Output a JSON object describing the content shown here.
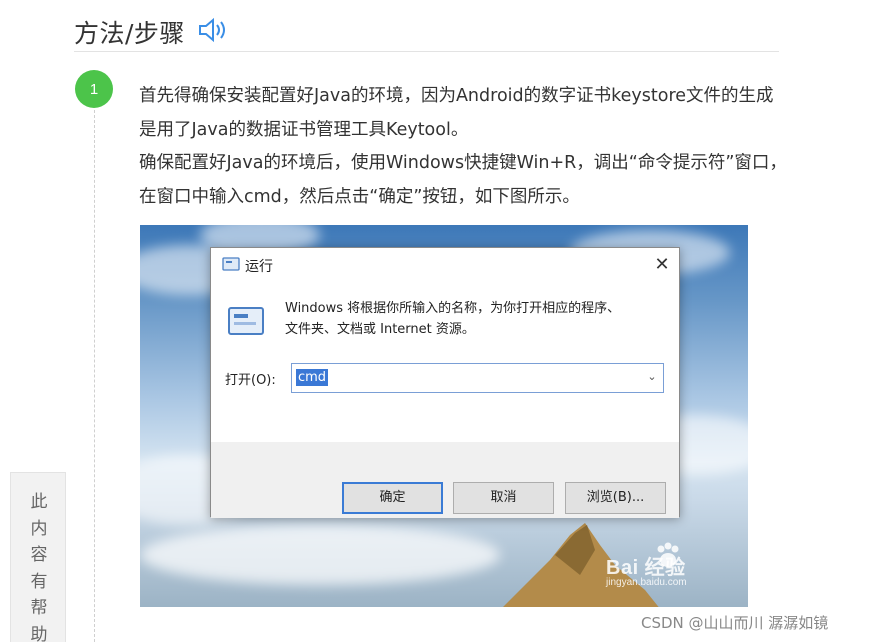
{
  "section": {
    "title": "方法/步骤",
    "speaker_icon": "speaker-icon"
  },
  "step": {
    "number": "1",
    "paragraphs": [
      "首先得确保安装配置好Java的环境，因为Android的数字证书keystore文件的生成是用了Java的数据证书管理工具Keytool。",
      "确保配置好Java的环境后，使用Windows快捷键Win+R，调出“命令提示符”窗口，在窗口中输入cmd，然后点击“确定”按钮，如下图所示。"
    ]
  },
  "run_dialog": {
    "title": "运行",
    "close_glyph": "✕",
    "description_line1": "Windows 将根据你所输入的名称，为你打开相应的程序、",
    "description_line2": "文件夹、文档或 Internet 资源。",
    "open_label": "打开(O):",
    "input_value": "cmd",
    "ok_label": "确定",
    "cancel_label": "取消",
    "browse_label": "浏览(B)..."
  },
  "image_watermark": {
    "brand": "Bai 经验",
    "url": "jingyan.baidu.com"
  },
  "helpful_tab": {
    "text": "此内容有帮助"
  },
  "page_watermark": "CSDN @山山而川 潺潺如镜",
  "colors": {
    "step_badge": "#4cc44a",
    "speaker_icon": "#3a8ee6",
    "dialog_accent": "#3a78d6"
  }
}
